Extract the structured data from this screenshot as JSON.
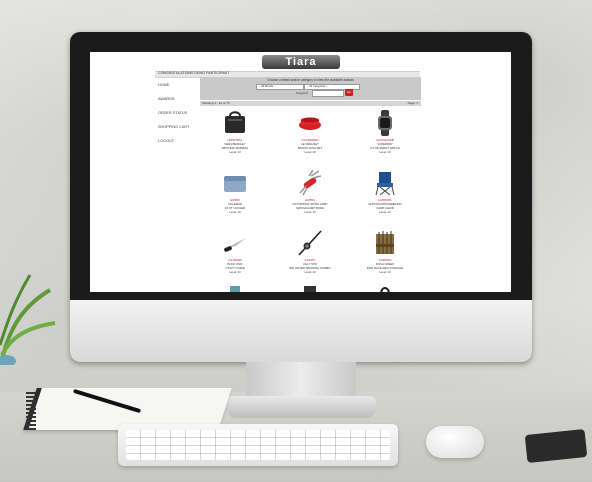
{
  "site": {
    "logo": "Tiara",
    "congrats_text": "CONGRATULATIONS DEMO PARTICIPANT"
  },
  "nav": {
    "items": [
      "HOME",
      "AWARDS",
      "ORDER STATUS",
      "SHOPPING CART",
      "LOGOUT"
    ]
  },
  "search": {
    "prompt": "Choose a brand and/or category to view the available awards",
    "brand_value": "-- All Brands --",
    "category_value": "-- All Categories --",
    "keyword_label": "Keyword:",
    "go_label": "Go"
  },
  "results": {
    "count_text": "Showing 1 - 12 of 75",
    "page_text": "Page: 1"
  },
  "products": [
    {
      "sku": "HM607BKL",
      "line1": "VERA BRADLEY",
      "line2": "HIPSTER HANDBAG",
      "level": "Level: 10"
    },
    {
      "sku": "CPV6800RD",
      "line1": "LE CREUSET",
      "line2": "BAKING DISH SET",
      "level": "Level: 10"
    },
    {
      "sku": "SKW6120SB",
      "line1": "SUPERDRY",
      "line2": "GT SB SMART WATCH",
      "level": "Level: 10"
    },
    {
      "sku": "HM655",
      "line1": "COLEMAN",
      "line2": "16 QT COOLER",
      "level": "Level: 10"
    },
    {
      "sku": "HM651",
      "line1": "VICTORINOX SWISS ARMY",
      "line2": "SWISSCHAMP KNIFE",
      "level": "Level: 10"
    },
    {
      "sku": "HM650RF",
      "line1": "ALPS MOUNTAINEERING",
      "line2": "CAMP CHAIR",
      "level": "Level: 10"
    },
    {
      "sku": "KS1800W",
      "line1": "BUCK KNIF",
      "line2": "UTILITY KNIFE",
      "level": "Level: 10"
    },
    {
      "sku": "KS1657",
      "line1": "UGLY STIK",
      "line2": "BIG WATER SPINNING COMBO",
      "level": "Level: 10"
    },
    {
      "sku": "KS3803N",
      "line1": "RUSH CREEK",
      "line2": "ROD RACK/ARM STORAGE",
      "level": "Level: 10"
    }
  ],
  "colors": {
    "accent_red": "#cc2222",
    "bezel": "#1b1b1b",
    "panel_gray": "#c9c9c9"
  },
  "icons": [
    "handbag-icon",
    "baking-dish-icon",
    "smartwatch-icon",
    "cooler-icon",
    "swiss-knife-icon",
    "camp-chair-icon",
    "utility-knife-icon",
    "fishing-rod-icon",
    "rod-rack-icon"
  ]
}
